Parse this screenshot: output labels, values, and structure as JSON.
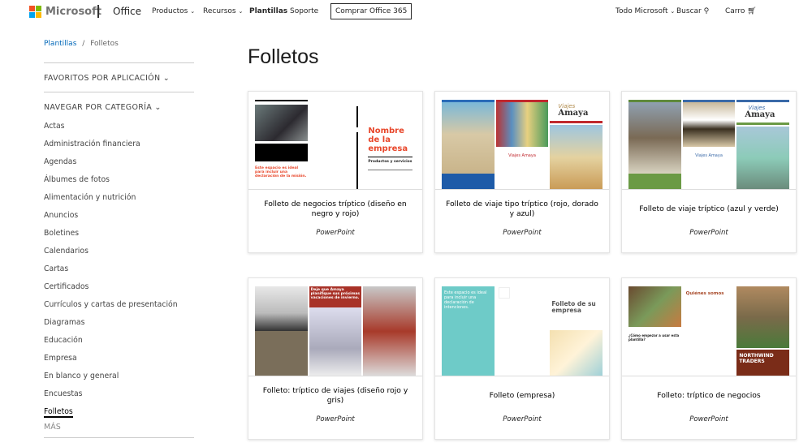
{
  "header": {
    "brand": "Microsoft",
    "product": "Office",
    "nav": [
      "Productos",
      "Recursos",
      "Plantillas",
      "Soporte"
    ],
    "buy": "Comprar Office 365",
    "all_ms": "Todo Microsoft",
    "search": "Buscar",
    "cart": "Carro",
    "logo_colors": [
      "#f25022",
      "#7fba00",
      "#00a4ef",
      "#ffb900"
    ]
  },
  "breadcrumb": {
    "root": "Plantillas",
    "sep": "/",
    "current": "Folletos"
  },
  "sidebar": {
    "favorites": "FAVORITOS POR APLICACIÓN",
    "browse": "NAVEGAR POR CATEGORÍA",
    "items": [
      "Actas",
      "Administración financiera",
      "Agendas",
      "Álbumes de fotos",
      "Alimentación y nutrición",
      "Anuncios",
      "Boletines",
      "Calendarios",
      "Cartas",
      "Certificados",
      "Currículos y cartas de presentación",
      "Diagramas",
      "Educación",
      "Empresa",
      "En blanco y general",
      "Encuestas",
      "Folletos"
    ],
    "active": "Folletos",
    "more": "MÁS"
  },
  "page": {
    "title": "Folletos"
  },
  "cards": [
    {
      "title": "Folleto de negocios tríptico (diseño en negro y rojo)",
      "app": "PowerPoint",
      "thumb": "Nombre de la empresa",
      "thumb2": "Productos y servicios",
      "thumb3": "Este espacio es ideal para incluir una declaración de la misión."
    },
    {
      "title": "Folleto de viaje tipo tríptico (rojo, dorado y azul)",
      "app": "PowerPoint",
      "thumb": "Viajes",
      "thumb2": "Amaya",
      "thumb3": "Viajes Amaya"
    },
    {
      "title": "Folleto de viaje tríptico (azul y verde)",
      "app": "PowerPoint",
      "thumb": "Viajes",
      "thumb2": "Amaya",
      "thumb3": "Viajes Amaya"
    },
    {
      "title": "Folleto: tríptico de viajes (diseño rojo y gris)",
      "app": "PowerPoint",
      "thumb": "Deje que Amaya planifique sus próximas vacaciones de invierno."
    },
    {
      "title": "Folleto (empresa)",
      "app": "PowerPoint",
      "thumb": "Folleto de su empresa",
      "thumb2": "Este espacio es ideal para incluir una declaración de intenciones."
    },
    {
      "title": "Folleto: tríptico de negocios",
      "app": "PowerPoint",
      "thumb": "Quiénes somos",
      "thumb2": "NORTHWIND TRADERS",
      "thumb3": "¿Cómo empezar a usar esta plantilla?"
    }
  ]
}
